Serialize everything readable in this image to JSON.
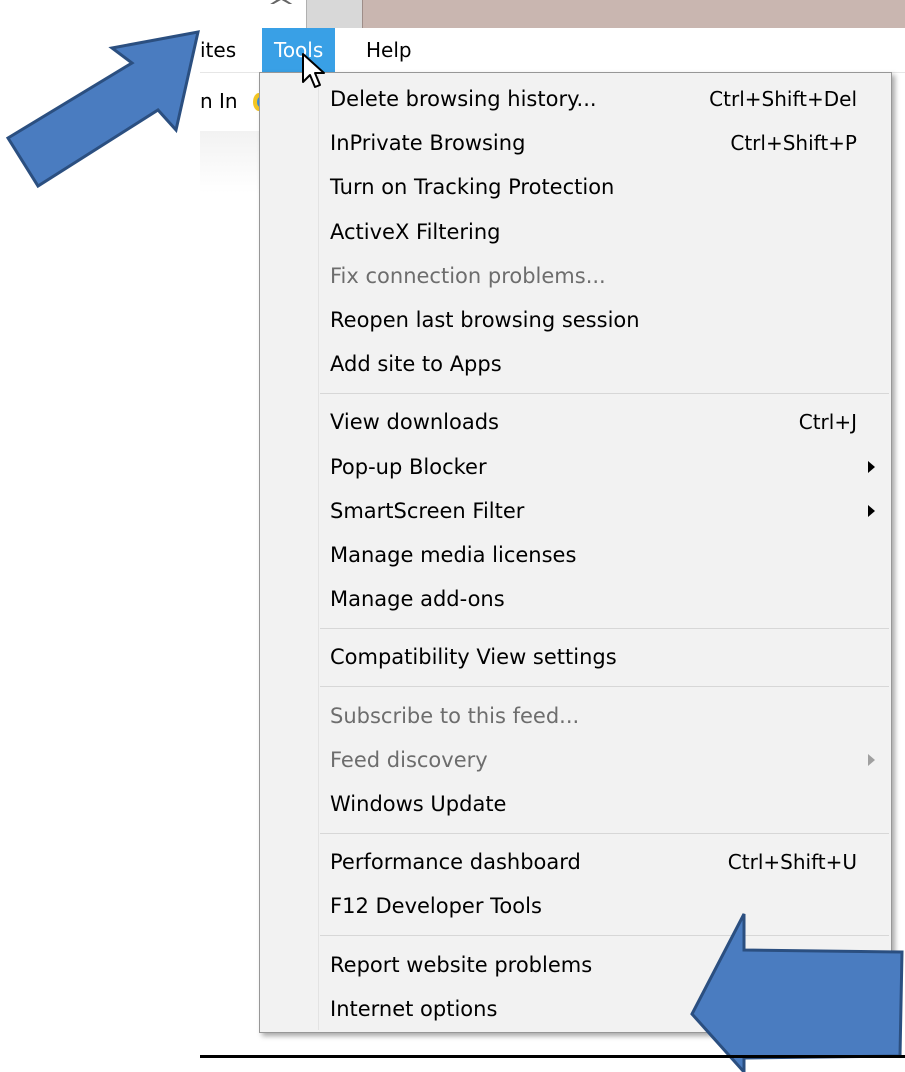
{
  "menubar": {
    "favorites_partial": "ites",
    "tools": "Tools",
    "help": "Help"
  },
  "favorites_bar": {
    "partial_text": "n In"
  },
  "menu": {
    "groups": [
      [
        {
          "label": "Delete browsing history...",
          "shortcut": "Ctrl+Shift+Del"
        },
        {
          "label": "InPrivate Browsing",
          "shortcut": "Ctrl+Shift+P"
        },
        {
          "label": "Turn on Tracking Protection",
          "shortcut": ""
        },
        {
          "label": "ActiveX Filtering",
          "shortcut": ""
        },
        {
          "label": "Fix connection problems...",
          "shortcut": "",
          "disabled": true
        },
        {
          "label": "Reopen last browsing session",
          "shortcut": ""
        },
        {
          "label": "Add site to Apps",
          "shortcut": ""
        }
      ],
      [
        {
          "label": "View downloads",
          "shortcut": "Ctrl+J"
        },
        {
          "label": "Pop-up Blocker",
          "shortcut": "",
          "submenu": true
        },
        {
          "label": "SmartScreen Filter",
          "shortcut": "",
          "submenu": true
        },
        {
          "label": "Manage media licenses",
          "shortcut": ""
        },
        {
          "label": "Manage add-ons",
          "shortcut": ""
        }
      ],
      [
        {
          "label": "Compatibility View settings",
          "shortcut": ""
        }
      ],
      [
        {
          "label": "Subscribe to this feed...",
          "shortcut": "",
          "disabled": true
        },
        {
          "label": "Feed discovery",
          "shortcut": "",
          "disabled": true,
          "submenu": true
        },
        {
          "label": "Windows Update",
          "shortcut": ""
        }
      ],
      [
        {
          "label": "Performance dashboard",
          "shortcut": "Ctrl+Shift+U"
        },
        {
          "label": "F12 Developer Tools",
          "shortcut": ""
        }
      ],
      [
        {
          "label": "Report website problems",
          "shortcut": ""
        },
        {
          "label": "Internet options",
          "shortcut": ""
        }
      ]
    ]
  },
  "colors": {
    "menu_highlight": "#39a0e6",
    "menu_background": "#f2f2f2",
    "annotation_arrow": "#4a7cc0",
    "annotation_arrow_border": "#2b4f80"
  }
}
